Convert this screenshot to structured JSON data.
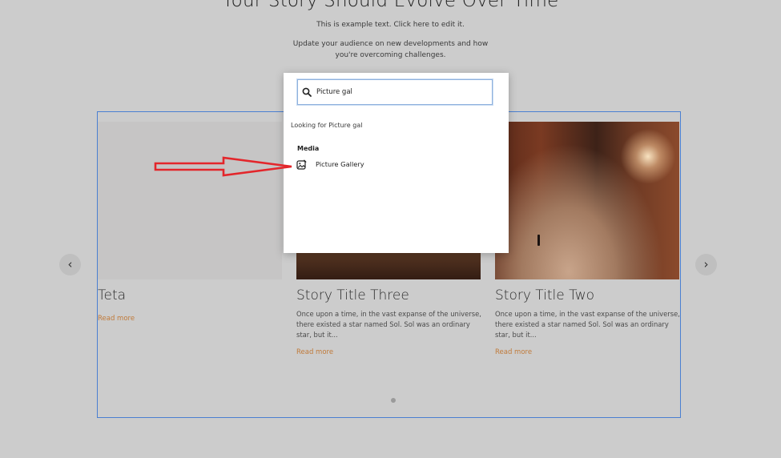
{
  "page": {
    "heading": "Your Story Should Evolve Over Time",
    "subtext_1": "This is example text. Click here to edit it.",
    "subtext_2_line1": "Update your audience on new developments and how",
    "subtext_2_line2": "you're overcoming challenges."
  },
  "gallery": {
    "cards": [
      {
        "title": "Teta",
        "description": "",
        "link": "Read more"
      },
      {
        "title": "Story Title Three",
        "description": "Once upon a time, in the vast expanse of the universe, there existed a star named Sol. Sol was an ordinary star, but it...",
        "link": "Read more"
      },
      {
        "title": "Story Title Two",
        "description": "Once upon a time, in the vast expanse of the universe, there existed a star named Sol. Sol was an ordinary star, but it...",
        "link": "Read more"
      }
    ],
    "prev_icon": "chevron-left-icon",
    "next_icon": "chevron-right-icon",
    "prev_glyph": "‹",
    "next_glyph": "›"
  },
  "search_popup": {
    "query": "Picture gal",
    "looking_for": "Looking for Picture gal",
    "section": "Media",
    "results": [
      {
        "label": "Picture Gallery",
        "icon": "picture-gallery-icon"
      }
    ]
  },
  "colors": {
    "background": "#cccccc",
    "selection_border": "#4a7fd1",
    "link": "#c07a3a",
    "annotation_arrow": "#e3262b"
  }
}
